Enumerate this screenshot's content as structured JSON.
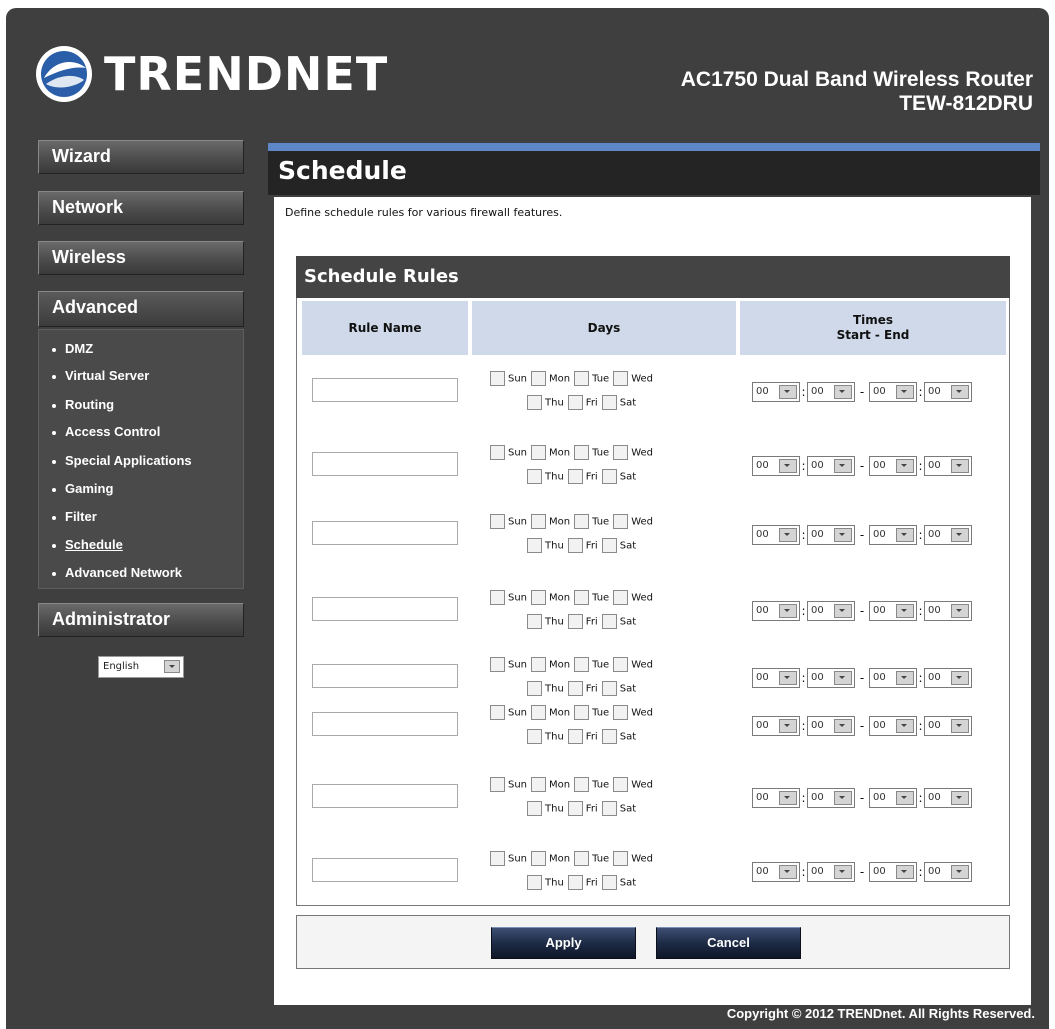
{
  "header": {
    "brand": "TRENDNET",
    "product": "AC1750 Dual Band Wireless Router",
    "model": "TEW-812DRU"
  },
  "sidebar": {
    "wizard": "Wizard",
    "network": "Network",
    "wireless": "Wireless",
    "advanced": "Advanced",
    "administrator": "Administrator",
    "items": [
      "DMZ",
      "Virtual Server",
      "Routing",
      "Access Control",
      "Special Applications",
      "Gaming",
      "Filter",
      "Schedule",
      "Advanced Network"
    ],
    "active_item": "Schedule",
    "language": "English"
  },
  "main": {
    "title": "Schedule",
    "description": "Define schedule rules for various firewall features.",
    "section_title": "Schedule Rules",
    "col_rule_name": "Rule Name",
    "col_days": "Days",
    "col_times_1": "Times",
    "col_times_2": "Start - End",
    "days": [
      "Sun",
      "Mon",
      "Tue",
      "Wed",
      "Thu",
      "Fri",
      "Sat"
    ],
    "time_value": "00",
    "rule_count": 8,
    "apply": "Apply",
    "cancel": "Cancel"
  },
  "footer": {
    "copyright": "Copyright © 2012 TRENDnet. All Rights Reserved."
  },
  "colors": {
    "accent_blue": "#5e87c7",
    "header_bg": "#3f3f3f",
    "column_header_bg": "#cfd9e9"
  }
}
